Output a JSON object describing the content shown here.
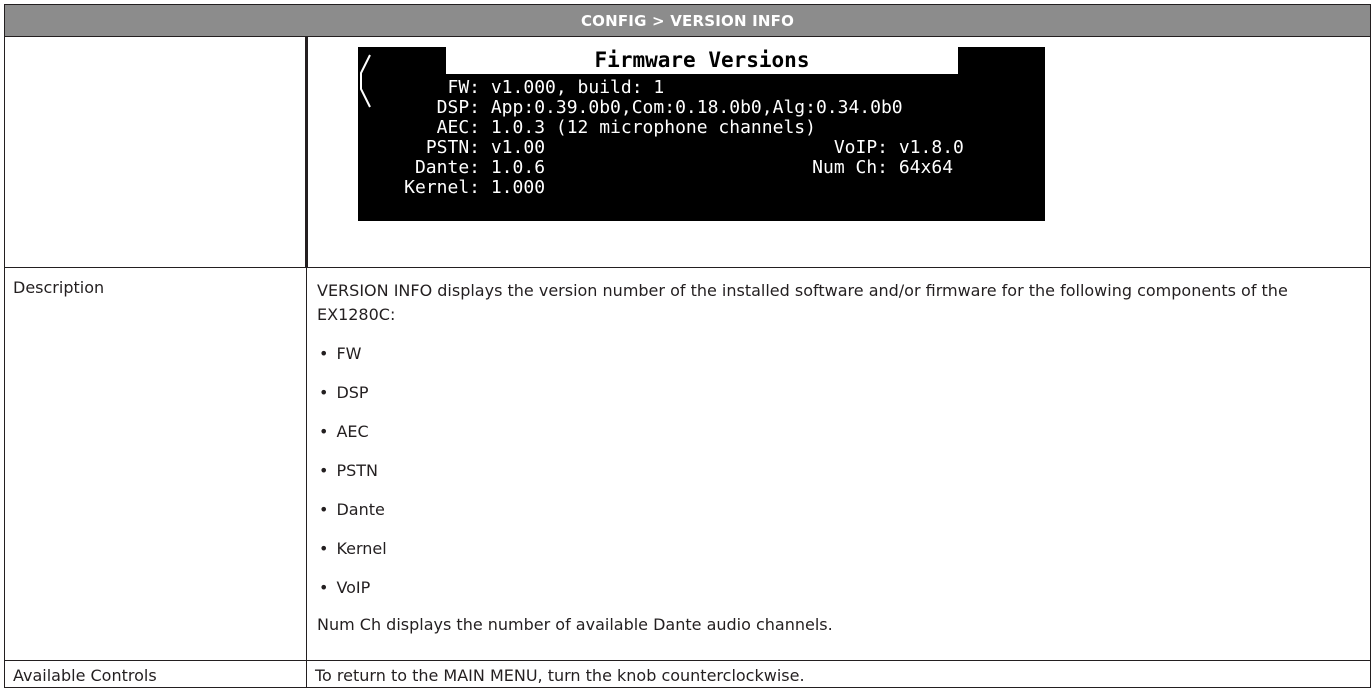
{
  "header": {
    "title": "CONFIG > VERSION INFO"
  },
  "screen": {
    "title": "Firmware Versions",
    "rows": [
      {
        "label": "FW:",
        "value": "v1.000, build: 1"
      },
      {
        "label": "DSP:",
        "value": "App:0.39.0b0,Com:0.18.0b0,Alg:0.34.0b0"
      },
      {
        "label": "AEC:",
        "value": "1.0.3 (12 microphone channels)"
      },
      {
        "label": "PSTN:",
        "value": "v1.00"
      },
      {
        "label": "Dante:",
        "value": "1.0.6"
      },
      {
        "label": "Kernel:",
        "value": "1.000"
      }
    ],
    "right_rows": [
      {
        "label": "VoIP:",
        "value": "v1.8.0"
      },
      {
        "label": "Num Ch:",
        "value": "64x64"
      }
    ]
  },
  "description": {
    "label": "Description",
    "intro": "VERSION INFO displays the version number of the installed software and/or firmware for the following components of the EX1280C:",
    "items": [
      "FW",
      "DSP",
      "AEC",
      "PSTN",
      "Dante",
      "Kernel",
      "VoIP"
    ],
    "tail": "Num Ch displays the number of available Dante audio channels."
  },
  "controls": {
    "label": "Available Controls",
    "text": "To return to the MAIN MENU, turn the knob counterclockwise."
  }
}
